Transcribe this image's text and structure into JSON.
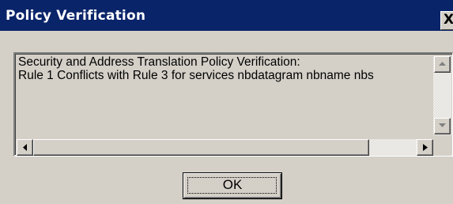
{
  "window": {
    "title": "Policy Verification",
    "close_glyph": "X"
  },
  "message": {
    "lines": [
      "Security and Address Translation  Policy Verification:",
      "Rule 1 Conflicts with Rule 3 for services nbdatagram nbname nbs"
    ]
  },
  "buttons": {
    "ok_label": "OK"
  },
  "icons": {
    "close": "close-icon",
    "scroll_up": "arrow-up-icon",
    "scroll_down": "arrow-down-icon",
    "scroll_left": "arrow-left-icon",
    "scroll_right": "arrow-right-icon"
  },
  "colors": {
    "titlebar": "#0a246a",
    "face": "#d4d0c8",
    "title_text": "#ffffff"
  }
}
